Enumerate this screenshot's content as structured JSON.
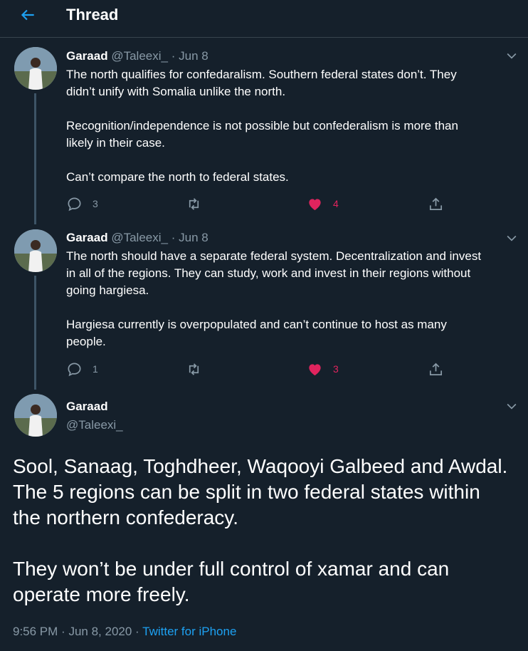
{
  "header": {
    "title": "Thread",
    "back_icon": "arrow-left-icon"
  },
  "colors": {
    "background": "#15202b",
    "accent": "#1da1f2",
    "like": "#e0245e",
    "muted": "#8899a6",
    "divider": "#38444d"
  },
  "tweets": [
    {
      "name": "Garaad",
      "handle": "@Taleexi_",
      "separator": "·",
      "date": "Jun 8",
      "lines": [
        "The north qualifies for confedaralism. Southern federal states don’t. They",
        "didn’t unify with Somalia unlike the north.",
        "",
        "Recognition/independence is not possible but confederalism is more than",
        "likely in their case.",
        "",
        "Can’t compare the north to federal states."
      ],
      "replies": "3",
      "retweets": "",
      "likes": "4",
      "liked": true
    },
    {
      "name": "Garaad",
      "handle": "@Taleexi_",
      "separator": "·",
      "date": "Jun 8",
      "lines": [
        "The north should have a separate federal system. Decentralization and invest",
        "in all of the regions. They can study, work and invest in their regions without",
        "going hargiesa.",
        "",
        "Hargiesa currently is overpopulated and can’t continue to host as many",
        "people."
      ],
      "replies": "1",
      "retweets": "",
      "likes": "3",
      "liked": true
    }
  ],
  "main": {
    "name": "Garaad",
    "handle": "@Taleexi_",
    "lines": [
      "Sool, Sanaag, Toghdheer, Waqooyi Galbeed and Awdal.",
      "The 5 regions can be split in two federal states within",
      "the northern confederacy.",
      "",
      "They won’t be under full control of xamar and can",
      "operate more freely."
    ],
    "time": "9:56 PM",
    "separator": "·",
    "date": "Jun 8, 2020",
    "separator2": "·",
    "source": "Twitter for iPhone"
  }
}
